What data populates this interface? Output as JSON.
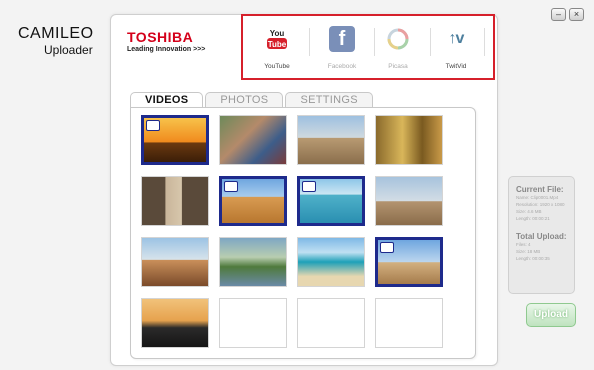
{
  "app": {
    "title_line1": "CAMILEO",
    "title_line2": "Uploader"
  },
  "window_controls": {
    "minimize": "–",
    "close": "×"
  },
  "brand": {
    "name": "TOSHIBA",
    "tagline": "Leading Innovation >>>"
  },
  "services": [
    {
      "name": "YouTube",
      "icon": "youtube-icon",
      "color": "#d6202b",
      "enabled": true
    },
    {
      "name": "Facebook",
      "icon": "facebook-icon",
      "color": "#7a8fb8",
      "enabled": false
    },
    {
      "name": "Picasa",
      "icon": "picasa-icon",
      "color": "#9bb0c2",
      "enabled": false
    },
    {
      "name": "TwitVid",
      "icon": "twitvid-icon",
      "color": "#5b8fb0",
      "enabled": true
    }
  ],
  "tabs": [
    {
      "label": "VIDEOS",
      "active": true
    },
    {
      "label": "PHOTOS",
      "active": false
    },
    {
      "label": "SETTINGS",
      "active": false
    }
  ],
  "thumbnails": [
    {
      "scene": "camel-sunset",
      "selected": true
    },
    {
      "scene": "crowd",
      "selected": false
    },
    {
      "scene": "ruins",
      "selected": false
    },
    {
      "scene": "temple-relief",
      "selected": false
    },
    {
      "scene": "doorway",
      "selected": false
    },
    {
      "scene": "pyramids-desert",
      "selected": true
    },
    {
      "scene": "sea-coast",
      "selected": true
    },
    {
      "scene": "sphinx",
      "selected": false
    },
    {
      "scene": "pyramids-camels",
      "selected": false
    },
    {
      "scene": "nile-village",
      "selected": false
    },
    {
      "scene": "beach",
      "selected": false
    },
    {
      "scene": "temple-camel",
      "selected": true
    },
    {
      "scene": "nile-sunset",
      "selected": false
    },
    {
      "scene": "empty",
      "selected": false
    },
    {
      "scene": "empty",
      "selected": false
    },
    {
      "scene": "empty",
      "selected": false
    }
  ],
  "current_file": {
    "heading": "Current File:",
    "name": "Name: Clip0001.Mp4",
    "resolution": "Resolution: 1920 x 1080",
    "size": "Size: 4.6 MB",
    "length": "Length: 00:00:21"
  },
  "total_upload": {
    "heading": "Total Upload:",
    "files": "Files: 4",
    "size": "Size: 18 MB",
    "length": "Length: 00:00:35"
  },
  "upload_button": "Upload",
  "colors": {
    "accent_red": "#d6202b",
    "selection_blue": "#1e2a8c"
  }
}
